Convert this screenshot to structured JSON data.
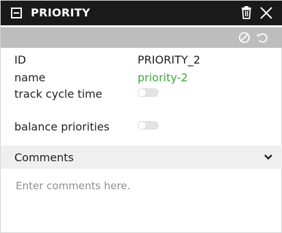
{
  "titlebar": {
    "title": "PRIORITY",
    "icons": [
      "minimize-icon",
      "trash-icon",
      "close-icon"
    ]
  },
  "toolbar": {
    "icons": [
      "cancel-icon",
      "undo-icon"
    ]
  },
  "properties": {
    "id_label": "ID",
    "id_value": "PRIORITY_2",
    "name_label": "name",
    "name_value": "priority-2",
    "name_color": "#39a935",
    "track_cycle_time_label": "track cycle time",
    "track_cycle_time_on": false,
    "balance_priorities_label": "balance priorities",
    "balance_priorities_on": false
  },
  "comments": {
    "header": "Comments",
    "placeholder": "Enter comments here."
  }
}
